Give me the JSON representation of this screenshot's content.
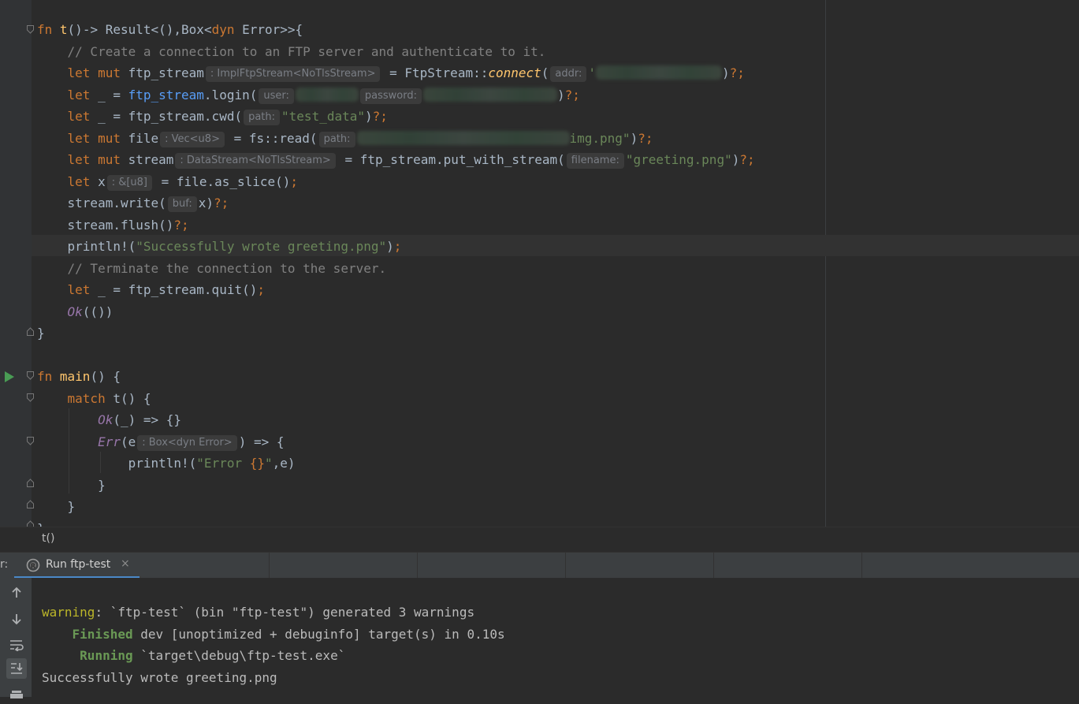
{
  "editor": {
    "lines": [
      {
        "segments": [
          {
            "t": "fn ",
            "c": "kw"
          },
          {
            "t": "t",
            "c": "fnname"
          },
          {
            "t": "()-> Result<(),Box<"
          },
          {
            "t": "dyn",
            "c": "kw"
          },
          {
            "t": " Error>>{"
          }
        ]
      },
      {
        "segments": [
          {
            "t": "    "
          },
          {
            "t": "// Create a connection to an FTP server and authenticate to it.",
            "c": "cmt"
          }
        ]
      },
      {
        "segments": [
          {
            "t": "    "
          },
          {
            "t": "let mut ",
            "c": "kw"
          },
          {
            "t": "ftp_stream"
          },
          {
            "t": ": ImplFtpStream<NoTlsStream>",
            "c": "hint"
          },
          {
            "t": " = FtpStream::"
          },
          {
            "t": "connect",
            "c": "call"
          },
          {
            "t": "("
          },
          {
            "t": "addr:",
            "c": "hint"
          },
          {
            "t": "'",
            "c": "str"
          },
          {
            "t": "",
            "c": "blur",
            "w": 160
          },
          {
            "t": ")"
          },
          {
            "t": "?;",
            "c": "punc"
          }
        ]
      },
      {
        "segments": [
          {
            "t": "    "
          },
          {
            "t": "let ",
            "c": "kw"
          },
          {
            "t": "_ = "
          },
          {
            "t": "ftp_stream",
            "c": "link"
          },
          {
            "t": ".login("
          },
          {
            "t": "user:",
            "c": "hint"
          },
          {
            "t": "",
            "c": "blur",
            "w": 80
          },
          {
            "t": "password:",
            "c": "hint"
          },
          {
            "t": "",
            "c": "blur",
            "w": 170
          },
          {
            "t": ")"
          },
          {
            "t": "?;",
            "c": "punc"
          }
        ]
      },
      {
        "segments": [
          {
            "t": "    "
          },
          {
            "t": "let ",
            "c": "kw"
          },
          {
            "t": "_ = ftp_stream.cwd("
          },
          {
            "t": "path:",
            "c": "hint"
          },
          {
            "t": "\"test_data\"",
            "c": "str"
          },
          {
            "t": ")"
          },
          {
            "t": "?;",
            "c": "punc"
          }
        ]
      },
      {
        "segments": [
          {
            "t": "    "
          },
          {
            "t": "let mut ",
            "c": "kw"
          },
          {
            "t": "file"
          },
          {
            "t": ": Vec<u8>",
            "c": "hint"
          },
          {
            "t": " = fs::read("
          },
          {
            "t": "path:",
            "c": "hint"
          },
          {
            "t": "",
            "c": "blur",
            "w": 270
          },
          {
            "t": "img.png\"",
            "c": "str"
          },
          {
            "t": ")"
          },
          {
            "t": "?;",
            "c": "punc"
          }
        ]
      },
      {
        "segments": [
          {
            "t": "    "
          },
          {
            "t": "let mut ",
            "c": "kw"
          },
          {
            "t": "stream"
          },
          {
            "t": ": DataStream<NoTlsStream>",
            "c": "hint"
          },
          {
            "t": " = ftp_stream.put_with_stream("
          },
          {
            "t": "filename:",
            "c": "hint"
          },
          {
            "t": "\"greeting.png\"",
            "c": "str"
          },
          {
            "t": ")"
          },
          {
            "t": "?;",
            "c": "punc"
          }
        ]
      },
      {
        "segments": [
          {
            "t": "    "
          },
          {
            "t": "let ",
            "c": "kw"
          },
          {
            "t": "x"
          },
          {
            "t": ": &[u8]",
            "c": "hint"
          },
          {
            "t": " = file.as_slice()"
          },
          {
            "t": ";",
            "c": "punc"
          }
        ]
      },
      {
        "segments": [
          {
            "t": "    "
          },
          {
            "t": "stream.write("
          },
          {
            "t": "buf:",
            "c": "hint"
          },
          {
            "t": "x)"
          },
          {
            "t": "?;",
            "c": "punc"
          }
        ]
      },
      {
        "segments": [
          {
            "t": "    "
          },
          {
            "t": "stream.flush()"
          },
          {
            "t": "?;",
            "c": "punc"
          }
        ]
      },
      {
        "segments": [
          {
            "t": "    "
          },
          {
            "t": "println!("
          },
          {
            "t": "\"Successfully wrote greeting.png\"",
            "c": "str"
          },
          {
            "t": ")"
          },
          {
            "t": ";",
            "c": "punc"
          }
        ]
      },
      {
        "segments": [
          {
            "t": "    "
          },
          {
            "t": "// Terminate the connection to the server.",
            "c": "cmt"
          }
        ]
      },
      {
        "segments": [
          {
            "t": "    "
          },
          {
            "t": "let ",
            "c": "kw"
          },
          {
            "t": "_ = ftp_stream.quit()"
          },
          {
            "t": ";",
            "c": "punc"
          }
        ]
      },
      {
        "segments": [
          {
            "t": "    "
          },
          {
            "t": "Ok",
            "c": "var"
          },
          {
            "t": "(())"
          }
        ]
      },
      {
        "segments": [
          {
            "t": "}"
          }
        ]
      },
      {
        "segments": []
      },
      {
        "segments": [
          {
            "t": "fn ",
            "c": "kw"
          },
          {
            "t": "main",
            "c": "fnname"
          },
          {
            "t": "() {"
          }
        ]
      },
      {
        "segments": [
          {
            "t": "    "
          },
          {
            "t": "match ",
            "c": "kw"
          },
          {
            "t": "t() {"
          }
        ]
      },
      {
        "segments": [
          {
            "t": "        "
          },
          {
            "t": "Ok",
            "c": "var"
          },
          {
            "t": "(_) => {}"
          }
        ]
      },
      {
        "segments": [
          {
            "t": "        "
          },
          {
            "t": "Err",
            "c": "var"
          },
          {
            "t": "(e"
          },
          {
            "t": ": Box<dyn Error>",
            "c": "hint"
          },
          {
            "t": ") => {"
          }
        ]
      },
      {
        "segments": [
          {
            "t": "            "
          },
          {
            "t": "println!("
          },
          {
            "t": "\"Error ",
            "c": "str"
          },
          {
            "t": "{}",
            "c": "punc"
          },
          {
            "t": "\"",
            "c": "str"
          },
          {
            "t": ",e)"
          }
        ]
      },
      {
        "segments": [
          {
            "t": "        "
          },
          {
            "t": "}"
          }
        ]
      },
      {
        "segments": [
          {
            "t": "    "
          },
          {
            "t": "}"
          }
        ]
      },
      {
        "segments": [
          {
            "t": "}"
          }
        ]
      }
    ]
  },
  "breadcrumb": {
    "label": "t()"
  },
  "tool_window": {
    "prefix": "r:",
    "tab_label": "Run ftp-test",
    "close_glyph": "×"
  },
  "console": {
    "lines": [
      {
        "segments": [
          {
            "t": "warning",
            "c": "warn"
          },
          {
            "t": ": `ftp-test` (bin \"ftp-test\") generated 3 warnings"
          }
        ]
      },
      {
        "segments": [
          {
            "t": "    "
          },
          {
            "t": "Finished",
            "c": "green"
          },
          {
            "t": " dev [unoptimized + debuginfo] target(s) in 0.10s"
          }
        ]
      },
      {
        "segments": [
          {
            "t": "     "
          },
          {
            "t": "Running",
            "c": "green"
          },
          {
            "t": " `target\\debug\\ftp-test.exe`"
          }
        ]
      },
      {
        "segments": [
          {
            "t": "Successfully wrote greeting.png"
          }
        ]
      }
    ],
    "tools": [
      {
        "name": "up-arrow-icon"
      },
      {
        "name": "down-arrow-icon"
      },
      {
        "name": "soft-wrap-icon"
      },
      {
        "name": "scroll-to-end-icon"
      },
      {
        "name": "print-icon"
      }
    ]
  }
}
